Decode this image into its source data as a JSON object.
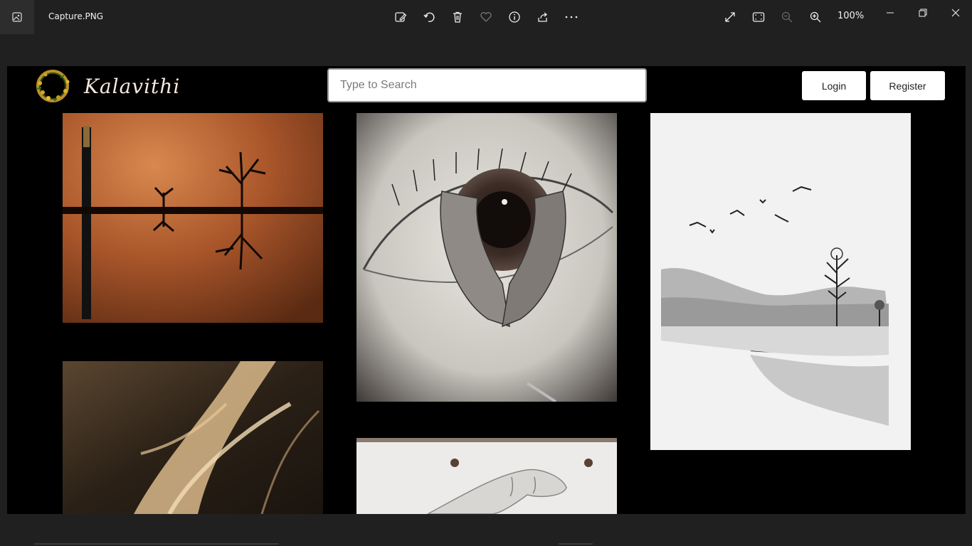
{
  "viewer": {
    "filename": "Capture.PNG",
    "zoom": "100%",
    "toolbar_icons": [
      "edit-image-icon",
      "rotate-icon",
      "delete-icon",
      "favorite-icon",
      "info-icon",
      "share-icon",
      "more-icon"
    ],
    "view_icons": [
      "fullscreen-icon",
      "fit-to-window-icon",
      "zoom-out-icon",
      "zoom-in-icon"
    ],
    "window_icons": [
      "minimize-icon",
      "restore-icon",
      "close-icon"
    ]
  },
  "site": {
    "logo_text": "Kalavithi",
    "search": {
      "placeholder": "Type to Search",
      "value": ""
    },
    "login_label": "Login",
    "register_label": "Register"
  },
  "gallery": {
    "items": [
      {
        "name": "tree-reflection-painting"
      },
      {
        "name": "eye-hands-sketch"
      },
      {
        "name": "landscape-ink-painting"
      },
      {
        "name": "abstract-gold-painting"
      },
      {
        "name": "hand-pencil-sketch"
      }
    ]
  },
  "colors": {
    "viewer_bg": "#202020",
    "site_bg": "#000000",
    "button_bg": "#ffffff"
  }
}
